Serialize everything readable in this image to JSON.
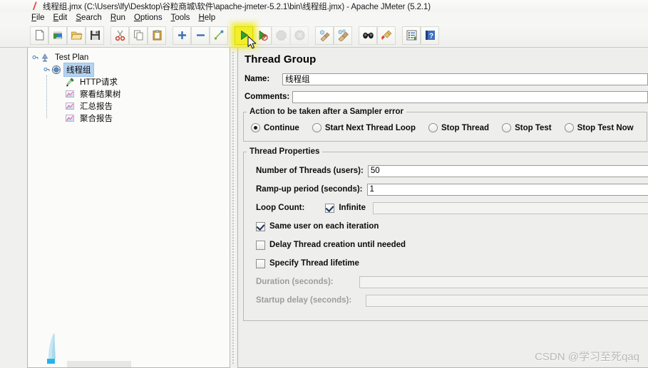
{
  "window": {
    "title": "线程组.jmx (C:\\Users\\lfy\\Desktop\\谷粒商城\\软件\\apache-jmeter-5.2.1\\bin\\线程组.jmx) - Apache JMeter (5.2.1)",
    "app_icon": "jmeter-logo-icon"
  },
  "menubar": {
    "items": [
      {
        "label": "File",
        "mnemonic": "F"
      },
      {
        "label": "Edit",
        "mnemonic": "E"
      },
      {
        "label": "Search",
        "mnemonic": "S"
      },
      {
        "label": "Run",
        "mnemonic": "R"
      },
      {
        "label": "Options",
        "mnemonic": "O"
      },
      {
        "label": "Tools",
        "mnemonic": "T"
      },
      {
        "label": "Help",
        "mnemonic": "H"
      }
    ]
  },
  "toolbar": {
    "highlight_color": "#f2ef2a",
    "buttons": [
      {
        "name": "new-icon",
        "tip": "New",
        "state": "enabled"
      },
      {
        "name": "templates-icon",
        "tip": "Templates",
        "state": "enabled"
      },
      {
        "name": "open-icon",
        "tip": "Open",
        "state": "enabled"
      },
      {
        "name": "save-icon",
        "tip": "Save Test Plan",
        "state": "enabled"
      },
      {
        "name": "cut-icon",
        "tip": "Cut",
        "state": "enabled"
      },
      {
        "name": "copy-icon",
        "tip": "Copy",
        "state": "enabled"
      },
      {
        "name": "paste-icon",
        "tip": "Paste",
        "state": "enabled"
      },
      {
        "name": "expand-all-icon",
        "tip": "Expand All",
        "state": "enabled"
      },
      {
        "name": "collapse-all-icon",
        "tip": "Collapse All",
        "state": "enabled"
      },
      {
        "name": "toggle-icon",
        "tip": "Toggle",
        "state": "enabled"
      },
      {
        "name": "start-icon",
        "tip": "Start",
        "state": "highlighted"
      },
      {
        "name": "start-no-timers-icon",
        "tip": "Start no pauses",
        "state": "enabled"
      },
      {
        "name": "stop-icon",
        "tip": "Stop",
        "state": "disabled"
      },
      {
        "name": "shutdown-icon",
        "tip": "Shutdown",
        "state": "disabled"
      },
      {
        "name": "clear-icon",
        "tip": "Clear",
        "state": "enabled"
      },
      {
        "name": "clear-all-icon",
        "tip": "Clear All",
        "state": "enabled"
      },
      {
        "name": "search-icon",
        "tip": "Search",
        "state": "enabled"
      },
      {
        "name": "reset-search-icon",
        "tip": "Reset Search",
        "state": "enabled"
      },
      {
        "name": "function-helper-icon",
        "tip": "Function Helper Dialog",
        "state": "enabled"
      },
      {
        "name": "help-icon",
        "tip": "Help",
        "state": "enabled"
      }
    ]
  },
  "tree": {
    "root": "Test Plan",
    "thread_group": "线程组",
    "children": [
      "HTTP请求",
      "察看结果树",
      "汇总报告",
      "聚合报告"
    ],
    "selected": "线程组",
    "selection_color": "#b5d2f0"
  },
  "panel": {
    "title": "Thread Group",
    "name_label": "Name:",
    "name_value": "线程组",
    "comments_label": "Comments:",
    "comments_value": "",
    "sampler_error": {
      "legend": "Action to be taken after a Sampler error",
      "options": [
        {
          "label": "Continue",
          "selected": true
        },
        {
          "label": "Start Next Thread Loop",
          "selected": false
        },
        {
          "label": "Stop Thread",
          "selected": false
        },
        {
          "label": "Stop Test",
          "selected": false
        },
        {
          "label": "Stop Test Now",
          "selected": false
        }
      ]
    },
    "thread_properties": {
      "legend": "Thread Properties",
      "num_threads_label": "Number of Threads (users):",
      "num_threads_value": "50",
      "rampup_label": "Ramp-up period (seconds):",
      "rampup_value": "1",
      "loop_count_label": "Loop Count:",
      "loop_infinite_label": "Infinite",
      "loop_infinite_checked": true,
      "loop_count_value": "",
      "same_user_label": "Same user on each iteration",
      "same_user_checked": true,
      "delay_thread_label": "Delay Thread creation until needed",
      "delay_thread_checked": false,
      "specify_lifetime_label": "Specify Thread lifetime",
      "specify_lifetime_checked": false,
      "duration_label": "Duration (seconds):",
      "duration_value": "",
      "startup_delay_label": "Startup delay (seconds):",
      "startup_delay_value": ""
    }
  },
  "watermark": {
    "text": "CSDN @学习至死qaq"
  }
}
